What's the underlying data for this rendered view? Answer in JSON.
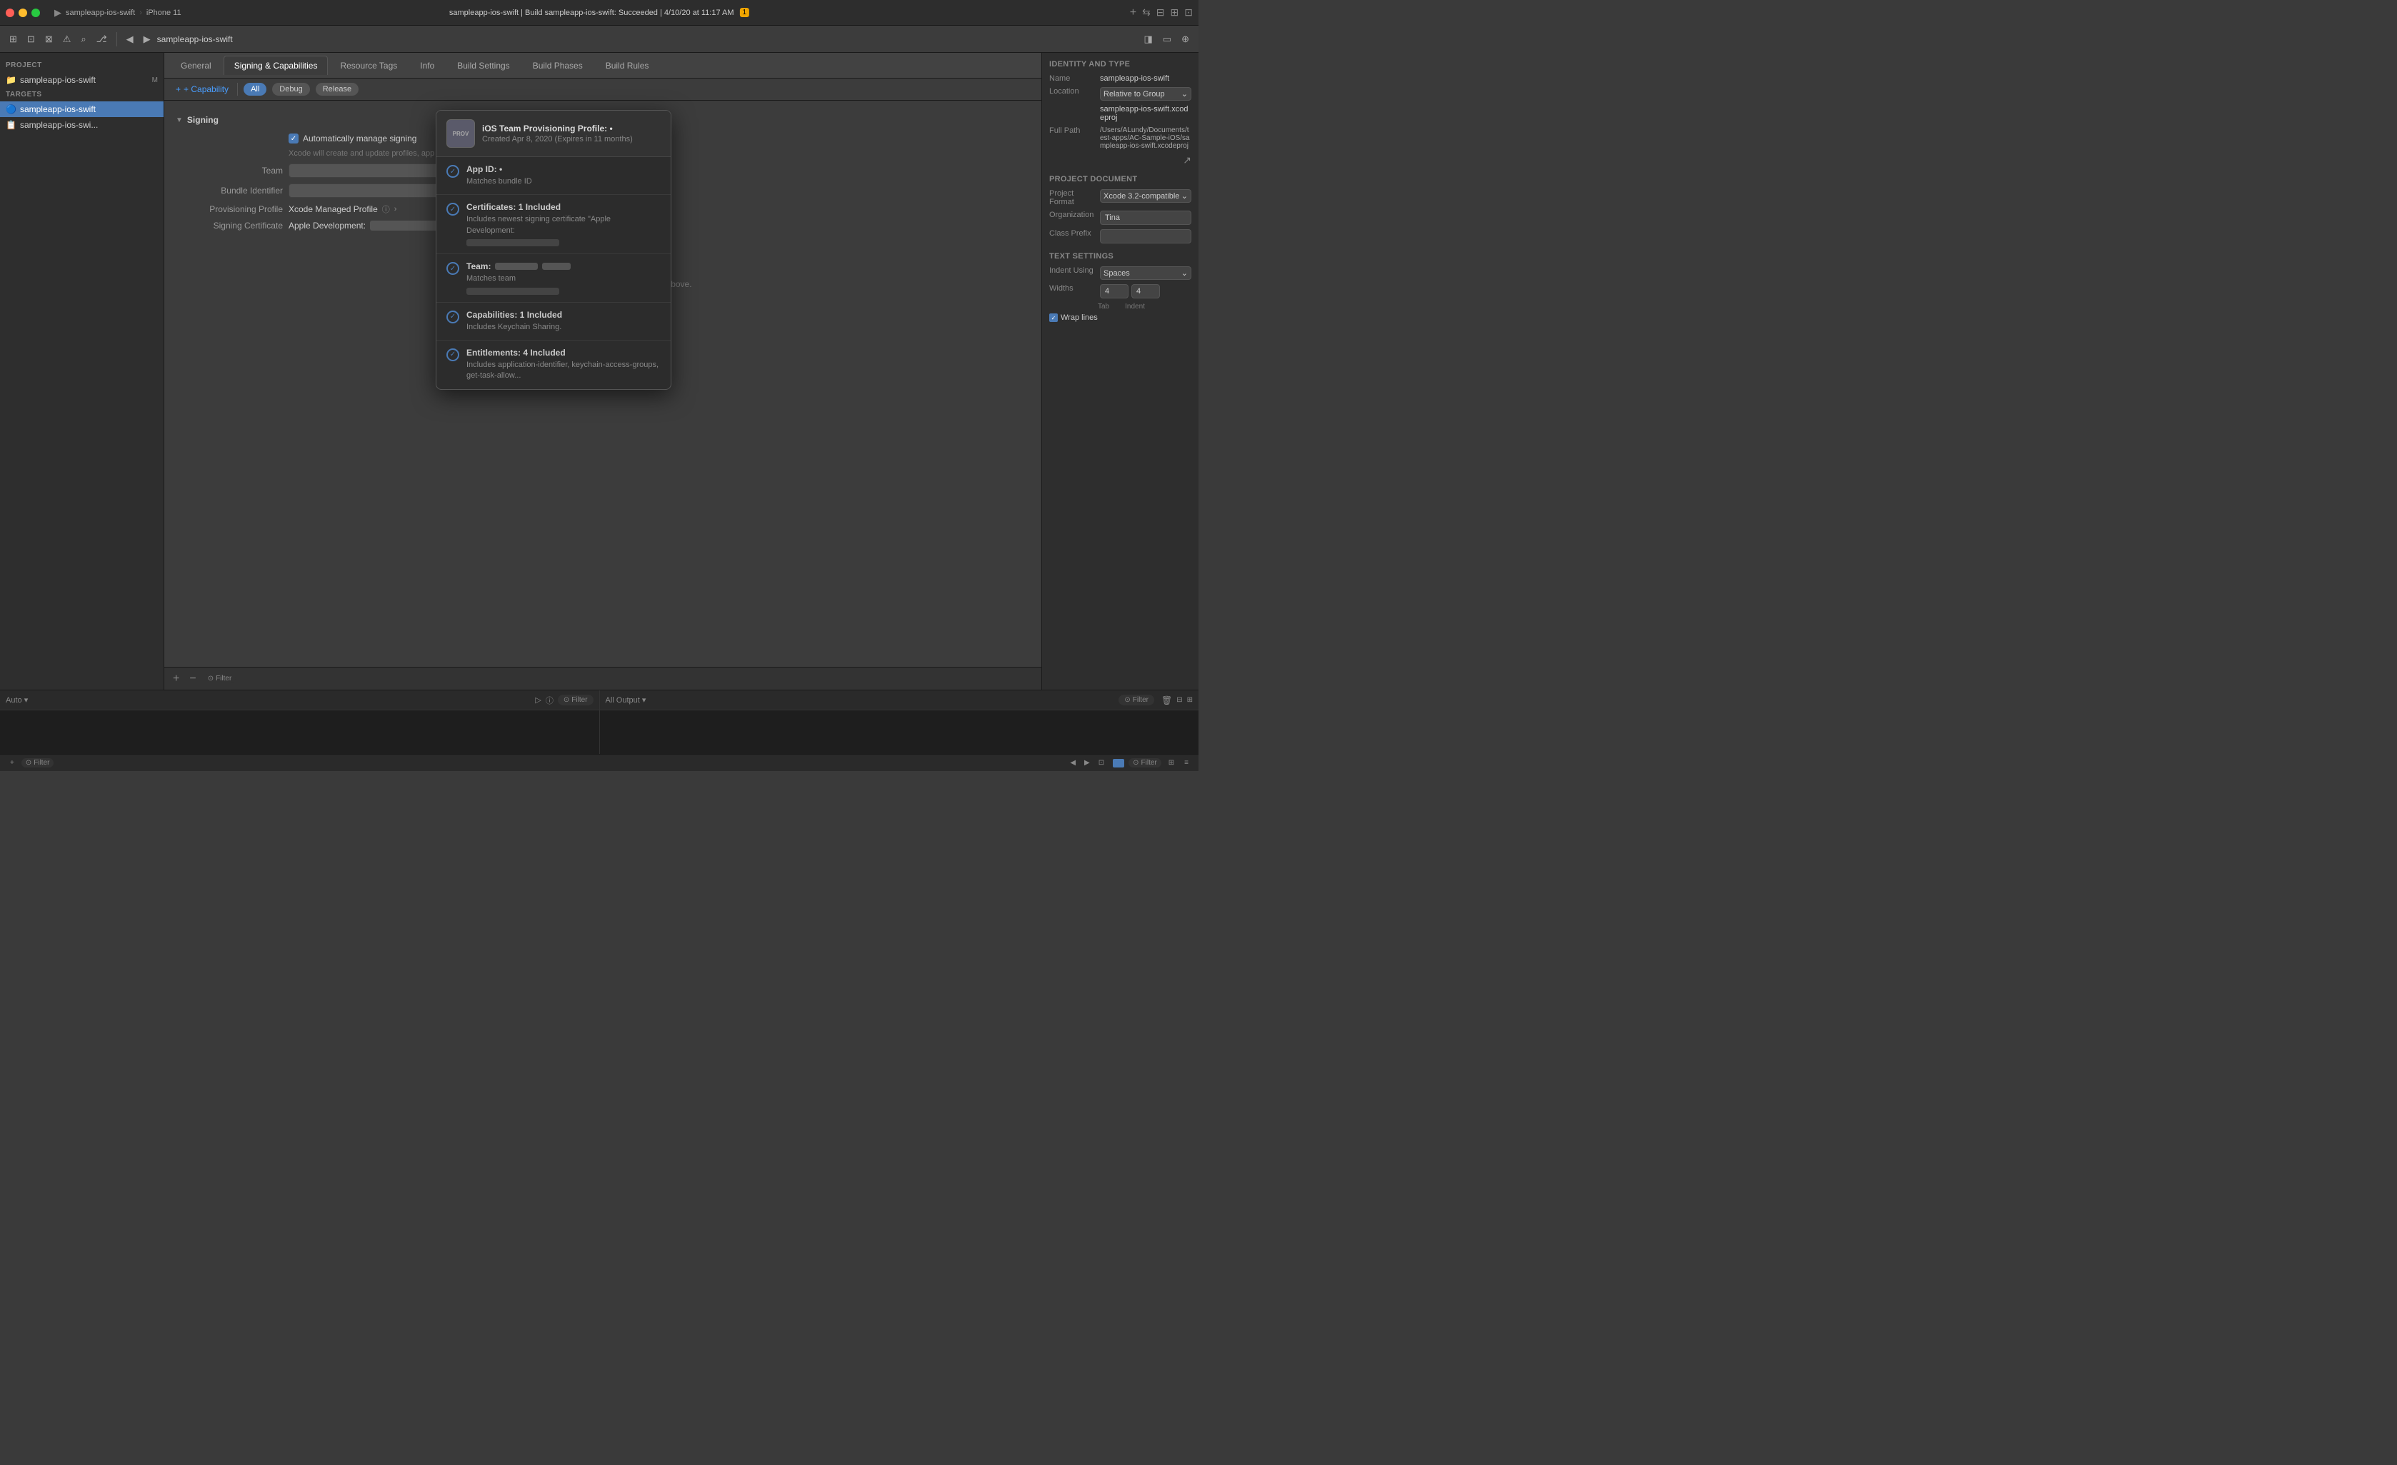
{
  "titlebar": {
    "project_name": "sampleapp-ios-swift",
    "device": "iPhone 11",
    "build_status": "sampleapp-ios-swift | Build sampleapp-ios-swift: Succeeded | 4/10/20 at 11:17 AM",
    "warning_count": "1",
    "nav_back": "◀",
    "nav_forward": "▶"
  },
  "toolbar": {
    "icons": [
      "⬜",
      "▶",
      "⏹",
      "⊡",
      "⊞",
      "⊡",
      "⊠",
      "◁▷"
    ],
    "breadcrumb": "sampleapp-ios-swift"
  },
  "sidebar": {
    "project_label": "PROJECT",
    "project_item": "sampleapp-ios-swift",
    "project_badge": "M",
    "targets_label": "TARGETS",
    "target1": "sampleapp-ios-swift",
    "target2": "sampleapp-ios-swi..."
  },
  "tabs": {
    "general": "General",
    "signing": "Signing & Capabilities",
    "resource_tags": "Resource Tags",
    "info": "Info",
    "build_settings": "Build Settings",
    "build_phases": "Build Phases",
    "build_rules": "Build Rules"
  },
  "capability_bar": {
    "add_label": "+ Capability",
    "all_label": "All",
    "debug_label": "Debug",
    "release_label": "Release"
  },
  "signing": {
    "section_title": "Signing",
    "auto_manage_label": "Automatically manage signing",
    "auto_manage_desc": "Xcode will create and update profiles, app IDs, and certificates.",
    "team_label": "Team",
    "bundle_id_label": "Bundle Identifier",
    "provisioning_label": "Provisioning Profile",
    "provisioning_value": "Xcode Managed Profile",
    "signing_cert_label": "Signing Certificate",
    "signing_cert_value": "Apple Development:"
  },
  "popup": {
    "title": "iOS Team Provisioning Profile: •",
    "subtitle": "Created Apr 8, 2020 (Expires in 11 months)",
    "icon_text": "PROV",
    "items": [
      {
        "title": "App ID: •",
        "desc": "Matches bundle ID",
        "has_bar": false
      },
      {
        "title": "Certificates: 1 Included",
        "desc": "Includes newest signing certificate \"Apple Development:",
        "has_bar": true
      },
      {
        "title": "Team:",
        "desc": "Matches team",
        "has_bar": true
      },
      {
        "title": "Capabilities: 1 Included",
        "desc": "Includes Keychain Sharing.",
        "has_bar": false
      },
      {
        "title": "Entitlements: 4 Included",
        "desc": "Includes application-identifier, keychain-access-groups, get-task-allow...",
        "has_bar": false
      }
    ]
  },
  "right_panel": {
    "identity_title": "Identity and Type",
    "name_label": "Name",
    "name_value": "sampleapp-ios-swift",
    "location_label": "Location",
    "location_value": "Relative to Group",
    "path_short_label": "",
    "path_short_value": "sampleapp-ios-swift.xcodeproj",
    "full_path_label": "Full Path",
    "full_path_value": "/Users/ALundy/Documents/test-apps/AC-Sample-iOS/sampleapp-ios-swift.xcodeproj",
    "project_doc_title": "Project Document",
    "format_label": "Project Format",
    "format_value": "Xcode 3.2-compatible",
    "org_label": "Organization",
    "org_value": "Tina",
    "class_prefix_label": "Class Prefix",
    "class_prefix_value": "",
    "text_settings_title": "Text Settings",
    "indent_using_label": "Indent Using",
    "indent_using_value": "Spaces",
    "widths_label": "Widths",
    "tab_value": "4",
    "indent_value": "4",
    "tab_label": "Tab",
    "indent_label": "Indent",
    "wrap_lines_label": "Wrap lines"
  },
  "bottom": {
    "add_label": "+",
    "remove_label": "−",
    "filter_label": "Filter"
  },
  "debug": {
    "auto_label": "Auto",
    "filter_label": "Filter",
    "all_output_label": "All Output",
    "filter2_label": "Filter"
  },
  "status": {
    "filter_label": "Filter"
  },
  "add_capabilities_hint": "Add capabilities by clicking the + button above."
}
